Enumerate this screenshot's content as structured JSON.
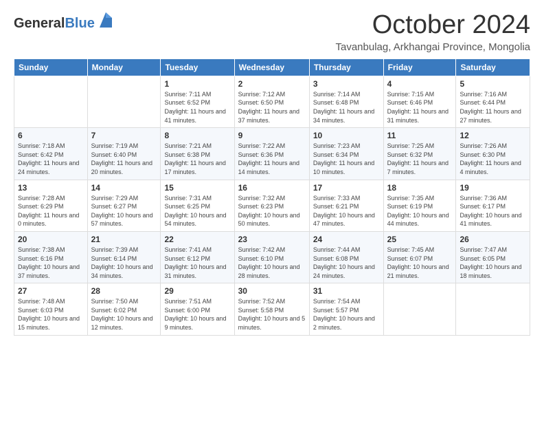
{
  "logo": {
    "general": "General",
    "blue": "Blue"
  },
  "header": {
    "month": "October 2024",
    "subtitle": "Tavanbulag, Arkhangai Province, Mongolia"
  },
  "weekdays": [
    "Sunday",
    "Monday",
    "Tuesday",
    "Wednesday",
    "Thursday",
    "Friday",
    "Saturday"
  ],
  "weeks": [
    [
      {
        "day": "",
        "info": ""
      },
      {
        "day": "",
        "info": ""
      },
      {
        "day": "1",
        "info": "Sunrise: 7:11 AM\nSunset: 6:52 PM\nDaylight: 11 hours and 41 minutes."
      },
      {
        "day": "2",
        "info": "Sunrise: 7:12 AM\nSunset: 6:50 PM\nDaylight: 11 hours and 37 minutes."
      },
      {
        "day": "3",
        "info": "Sunrise: 7:14 AM\nSunset: 6:48 PM\nDaylight: 11 hours and 34 minutes."
      },
      {
        "day": "4",
        "info": "Sunrise: 7:15 AM\nSunset: 6:46 PM\nDaylight: 11 hours and 31 minutes."
      },
      {
        "day": "5",
        "info": "Sunrise: 7:16 AM\nSunset: 6:44 PM\nDaylight: 11 hours and 27 minutes."
      }
    ],
    [
      {
        "day": "6",
        "info": "Sunrise: 7:18 AM\nSunset: 6:42 PM\nDaylight: 11 hours and 24 minutes."
      },
      {
        "day": "7",
        "info": "Sunrise: 7:19 AM\nSunset: 6:40 PM\nDaylight: 11 hours and 20 minutes."
      },
      {
        "day": "8",
        "info": "Sunrise: 7:21 AM\nSunset: 6:38 PM\nDaylight: 11 hours and 17 minutes."
      },
      {
        "day": "9",
        "info": "Sunrise: 7:22 AM\nSunset: 6:36 PM\nDaylight: 11 hours and 14 minutes."
      },
      {
        "day": "10",
        "info": "Sunrise: 7:23 AM\nSunset: 6:34 PM\nDaylight: 11 hours and 10 minutes."
      },
      {
        "day": "11",
        "info": "Sunrise: 7:25 AM\nSunset: 6:32 PM\nDaylight: 11 hours and 7 minutes."
      },
      {
        "day": "12",
        "info": "Sunrise: 7:26 AM\nSunset: 6:30 PM\nDaylight: 11 hours and 4 minutes."
      }
    ],
    [
      {
        "day": "13",
        "info": "Sunrise: 7:28 AM\nSunset: 6:29 PM\nDaylight: 11 hours and 0 minutes."
      },
      {
        "day": "14",
        "info": "Sunrise: 7:29 AM\nSunset: 6:27 PM\nDaylight: 10 hours and 57 minutes."
      },
      {
        "day": "15",
        "info": "Sunrise: 7:31 AM\nSunset: 6:25 PM\nDaylight: 10 hours and 54 minutes."
      },
      {
        "day": "16",
        "info": "Sunrise: 7:32 AM\nSunset: 6:23 PM\nDaylight: 10 hours and 50 minutes."
      },
      {
        "day": "17",
        "info": "Sunrise: 7:33 AM\nSunset: 6:21 PM\nDaylight: 10 hours and 47 minutes."
      },
      {
        "day": "18",
        "info": "Sunrise: 7:35 AM\nSunset: 6:19 PM\nDaylight: 10 hours and 44 minutes."
      },
      {
        "day": "19",
        "info": "Sunrise: 7:36 AM\nSunset: 6:17 PM\nDaylight: 10 hours and 41 minutes."
      }
    ],
    [
      {
        "day": "20",
        "info": "Sunrise: 7:38 AM\nSunset: 6:16 PM\nDaylight: 10 hours and 37 minutes."
      },
      {
        "day": "21",
        "info": "Sunrise: 7:39 AM\nSunset: 6:14 PM\nDaylight: 10 hours and 34 minutes."
      },
      {
        "day": "22",
        "info": "Sunrise: 7:41 AM\nSunset: 6:12 PM\nDaylight: 10 hours and 31 minutes."
      },
      {
        "day": "23",
        "info": "Sunrise: 7:42 AM\nSunset: 6:10 PM\nDaylight: 10 hours and 28 minutes."
      },
      {
        "day": "24",
        "info": "Sunrise: 7:44 AM\nSunset: 6:08 PM\nDaylight: 10 hours and 24 minutes."
      },
      {
        "day": "25",
        "info": "Sunrise: 7:45 AM\nSunset: 6:07 PM\nDaylight: 10 hours and 21 minutes."
      },
      {
        "day": "26",
        "info": "Sunrise: 7:47 AM\nSunset: 6:05 PM\nDaylight: 10 hours and 18 minutes."
      }
    ],
    [
      {
        "day": "27",
        "info": "Sunrise: 7:48 AM\nSunset: 6:03 PM\nDaylight: 10 hours and 15 minutes."
      },
      {
        "day": "28",
        "info": "Sunrise: 7:50 AM\nSunset: 6:02 PM\nDaylight: 10 hours and 12 minutes."
      },
      {
        "day": "29",
        "info": "Sunrise: 7:51 AM\nSunset: 6:00 PM\nDaylight: 10 hours and 9 minutes."
      },
      {
        "day": "30",
        "info": "Sunrise: 7:52 AM\nSunset: 5:58 PM\nDaylight: 10 hours and 5 minutes."
      },
      {
        "day": "31",
        "info": "Sunrise: 7:54 AM\nSunset: 5:57 PM\nDaylight: 10 hours and 2 minutes."
      },
      {
        "day": "",
        "info": ""
      },
      {
        "day": "",
        "info": ""
      }
    ]
  ]
}
